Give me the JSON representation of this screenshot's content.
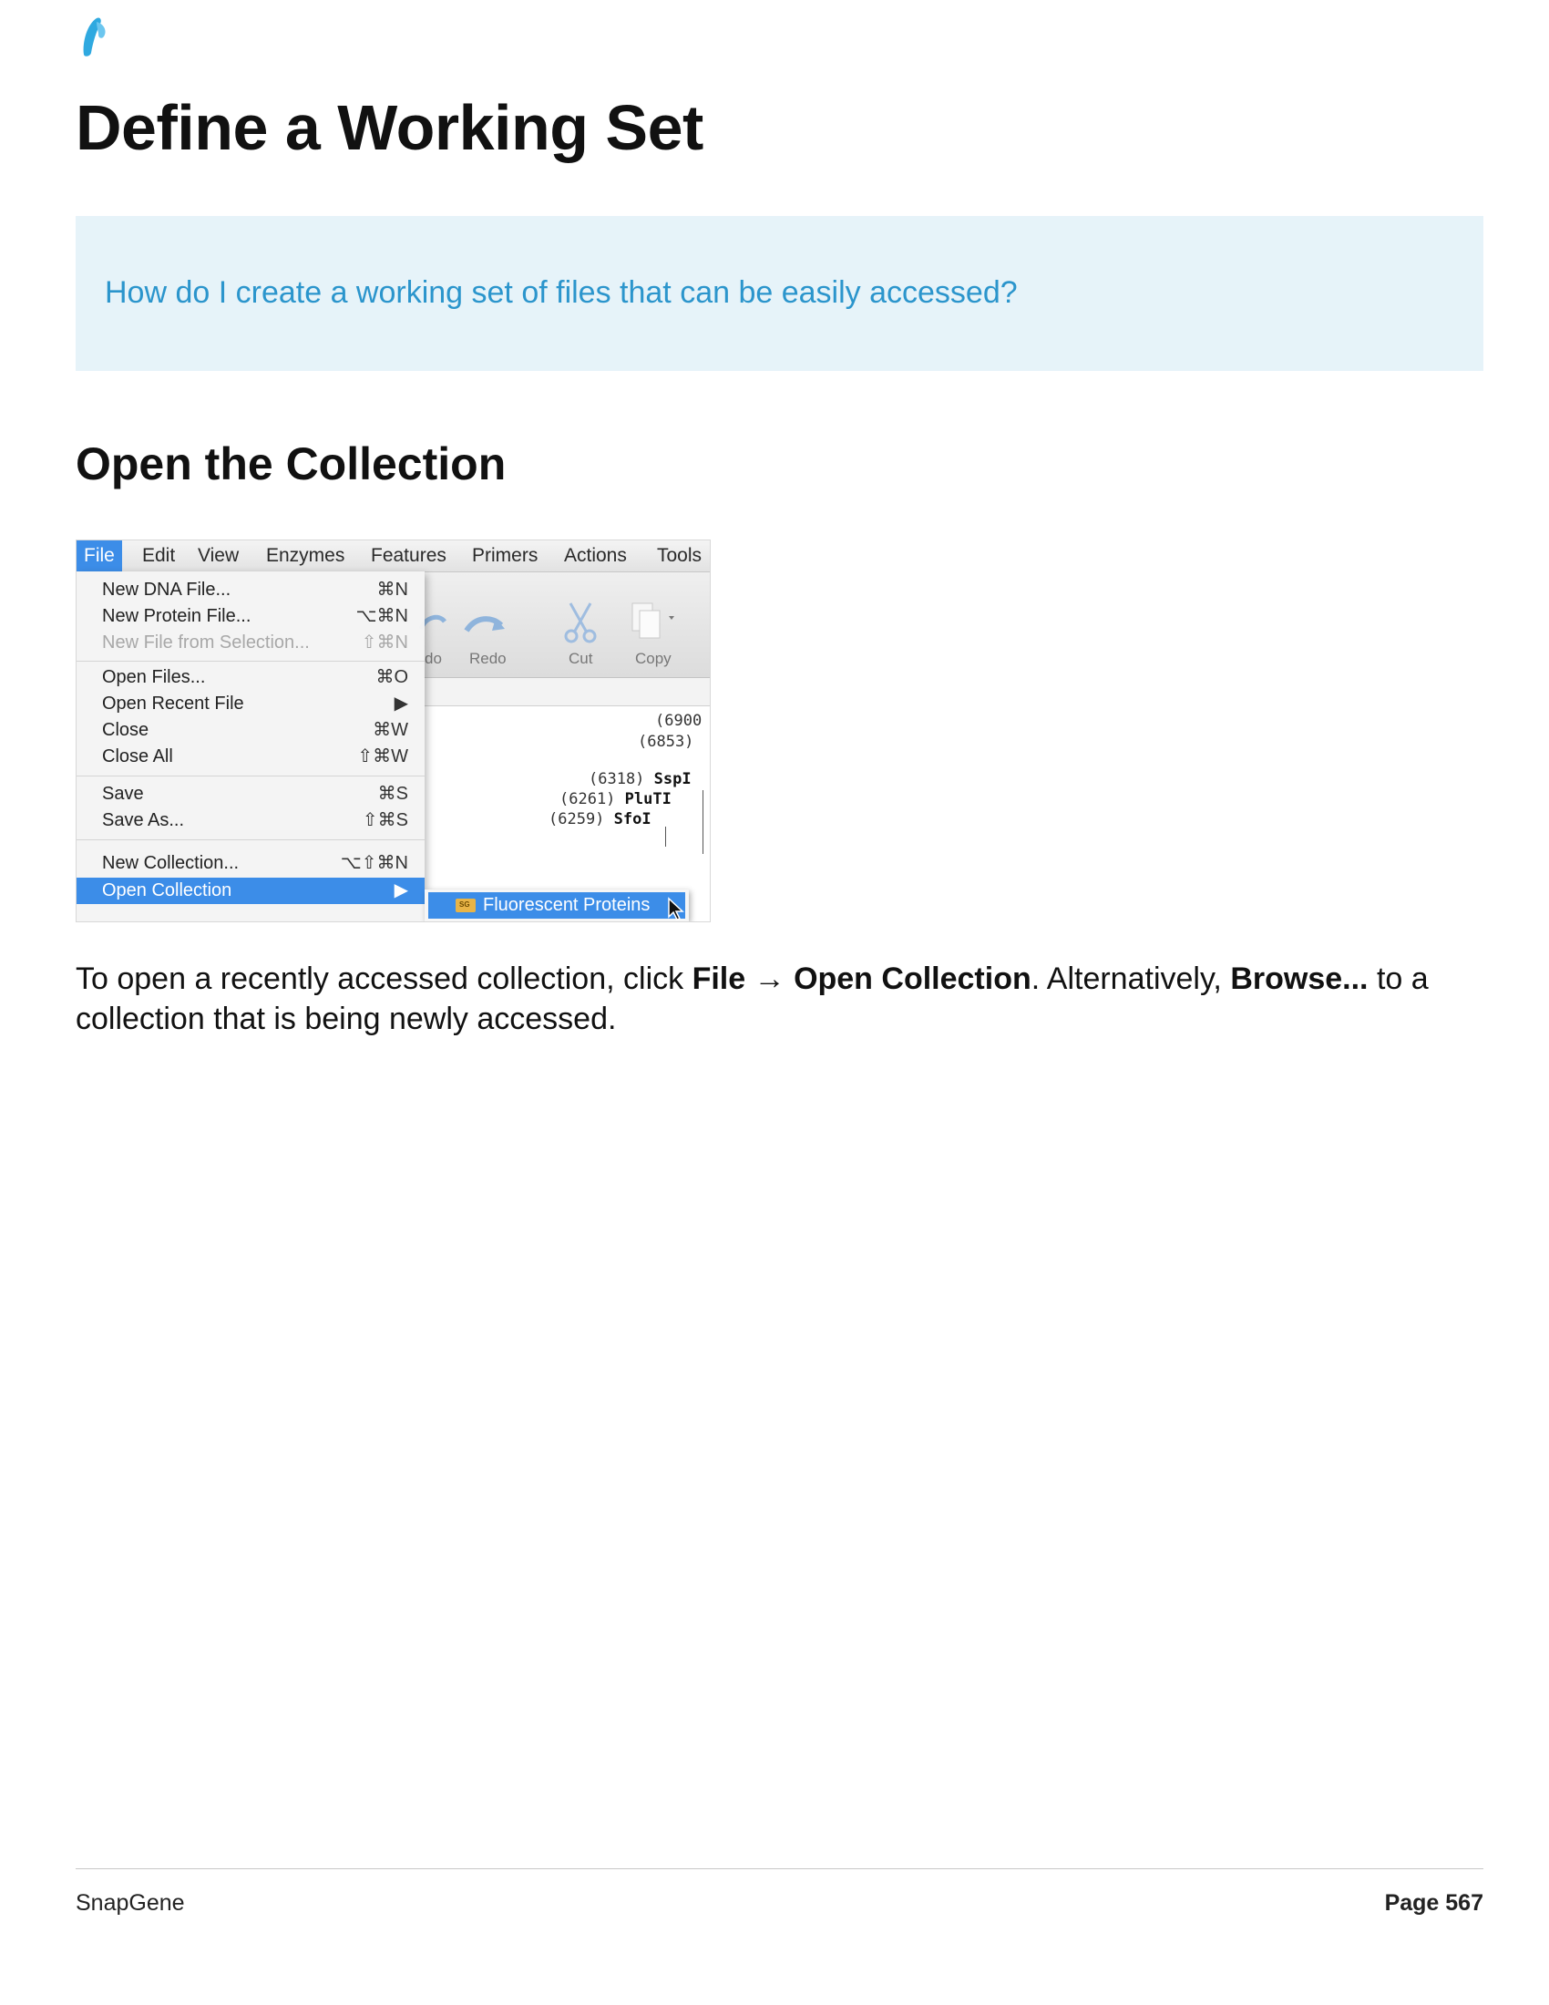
{
  "logo_icon": "snapgene-logo-icon",
  "title": "Define a Working Set",
  "callout": {
    "question": "How do I create a working set of files that can be easily accessed?"
  },
  "section": {
    "title": "Open the Collection"
  },
  "screenshot": {
    "menubar": [
      "File",
      "Edit",
      "View",
      "Enzymes",
      "Features",
      "Primers",
      "Actions",
      "Tools"
    ],
    "toolbar": {
      "undo": "do",
      "redo": "Redo",
      "cut": "Cut",
      "copy": "Copy"
    },
    "menu": [
      {
        "label": "New DNA File...",
        "shortcut": "⌘N"
      },
      {
        "label": "New Protein File...",
        "shortcut": "⌥⌘N"
      },
      {
        "label": "New File from Selection...",
        "shortcut": "⇧⌘N"
      },
      {
        "label": "Open Files...",
        "shortcut": "⌘O"
      },
      {
        "label": "Open Recent File",
        "shortcut": "▶"
      },
      {
        "label": "Close",
        "shortcut": "⌘W"
      },
      {
        "label": "Close All",
        "shortcut": "⇧⌘W"
      },
      {
        "label": "Save",
        "shortcut": "⌘S"
      },
      {
        "label": "Save As...",
        "shortcut": "⇧⌘S"
      },
      {
        "label": "New Collection...",
        "shortcut": "⌥⇧⌘N"
      },
      {
        "label": "Open Collection",
        "shortcut": "▶"
      }
    ],
    "submenu": {
      "label": "Fluorescent Proteins",
      "icon_badge": "SG"
    },
    "enzymes": [
      {
        "pos": "(6900",
        "name": ""
      },
      {
        "pos": "(6853)",
        "name": ""
      },
      {
        "pos": "(6318)",
        "name": "SspI"
      },
      {
        "pos": "(6261)",
        "name": "PluTI"
      },
      {
        "pos": "(6259)",
        "name": "SfoI"
      }
    ]
  },
  "body": {
    "t1": "To open a recently accessed collection, click ",
    "b1": "File",
    "arrow": " → ",
    "b2": "Open Collection",
    "t2": ". Alternatively, ",
    "b3": "Browse...",
    "t3": " to a collection that is being newly accessed."
  },
  "footer": {
    "left": "SnapGene",
    "right": "Page 567"
  },
  "colors": {
    "accent": "#2b95cc",
    "callout_bg": "#e6f3f9",
    "menu_highlight": "#3c8de8"
  }
}
